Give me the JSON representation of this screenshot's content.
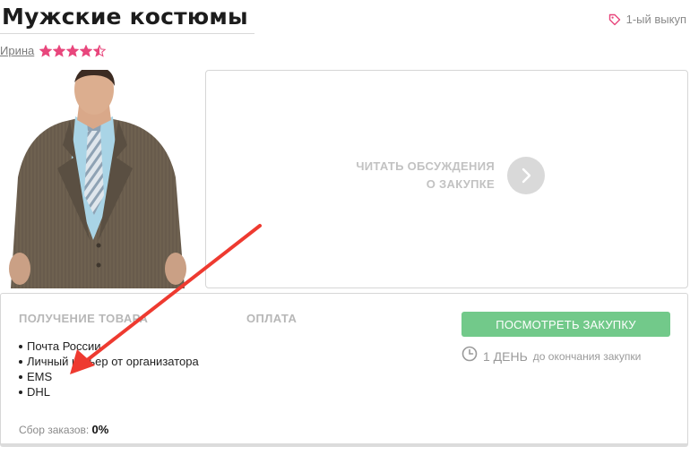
{
  "header": {
    "title": "Мужские костюмы",
    "purchase_badge": "1-ый выкуп"
  },
  "organizer": {
    "name": "Ирина",
    "rating_stars": 4.5,
    "rating_max": 5
  },
  "discussion": {
    "label_line1": "ЧИТАТЬ ОБСУЖДЕНИЯ",
    "label_line2": "О ЗАКУПКЕ"
  },
  "delivery": {
    "heading": "ПОЛУЧЕНИЕ ТОВАРА",
    "methods": [
      "Почта России",
      "Личный курьер от организатора",
      "EMS",
      "DHL"
    ]
  },
  "payment": {
    "heading": "ОПЛАТА"
  },
  "orders": {
    "label": "Сбор заказов:",
    "value": "0%"
  },
  "action": {
    "view_button": "ПОСМОТРЕТЬ ЗАКУПКУ",
    "deadline_value": "1 ДЕНЬ",
    "deadline_suffix": "до окончания закупки"
  },
  "colors": {
    "accent_green": "#72c98a",
    "star_pink": "#e8467c",
    "annotation_red": "#ee3a30",
    "badge_pink": "#e8467c"
  },
  "icons": {
    "badge": "tag-icon",
    "rating": "star-icon",
    "discussion": "chevron-right-icon",
    "deadline": "clock-icon"
  }
}
